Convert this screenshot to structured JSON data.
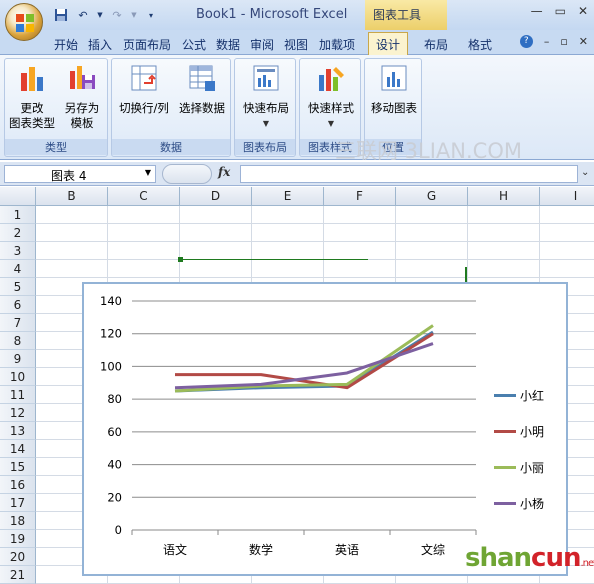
{
  "window": {
    "title": "Book1 - Microsoft Excel",
    "context_tools": "图表工具",
    "controls": [
      "—",
      "▭",
      "✕"
    ]
  },
  "tabs": [
    "开始",
    "插入",
    "页面布局",
    "公式",
    "数据",
    "审阅",
    "视图",
    "加载项",
    "设计",
    "布局",
    "格式"
  ],
  "active_tab": "设计",
  "ribbon": {
    "groups": [
      {
        "label": "类型",
        "buttons": [
          {
            "label": "更改\n图表类型",
            "icon": "change-chart-type-icon"
          },
          {
            "label": "另存为\n模板",
            "icon": "save-template-icon"
          }
        ]
      },
      {
        "label": "数据",
        "buttons": [
          {
            "label": "切换行/列",
            "icon": "switch-row-col-icon"
          },
          {
            "label": "选择数据",
            "icon": "select-data-icon"
          }
        ]
      },
      {
        "label": "图表布局",
        "buttons": [
          {
            "label": "快速布局",
            "icon": "quick-layout-icon"
          }
        ]
      },
      {
        "label": "图表样式",
        "buttons": [
          {
            "label": "快速样式",
            "icon": "quick-style-icon"
          }
        ]
      },
      {
        "label": "位置",
        "buttons": [
          {
            "label": "移动图表",
            "icon": "move-chart-icon"
          }
        ]
      }
    ]
  },
  "formula_bar": {
    "name_box": "图表 4",
    "fx": "fx",
    "value": ""
  },
  "sheet": {
    "columns": [
      "B",
      "C",
      "D",
      "E",
      "F",
      "G",
      "H",
      "I"
    ],
    "rows": [
      "1",
      "2",
      "3",
      "4",
      "5",
      "6",
      "7",
      "8",
      "9",
      "10",
      "11",
      "12",
      "13",
      "14",
      "15",
      "16",
      "17",
      "18",
      "19",
      "20",
      "21"
    ]
  },
  "watermark": "三联网 3LIAN.COM",
  "site_logo": {
    "part1": "shan",
    "part2": "cun",
    "suffix": ".net"
  },
  "chart_data": {
    "type": "line",
    "categories": [
      "语文",
      "数学",
      "英语",
      "文综"
    ],
    "ylim": [
      0,
      140
    ],
    "yticks": [
      0,
      20,
      40,
      60,
      80,
      100,
      120,
      140
    ],
    "grid": true,
    "legend_position": "right",
    "series": [
      {
        "name": "小红",
        "color": "#4a7fae",
        "values": [
          85,
          87,
          88,
          121
        ]
      },
      {
        "name": "小明",
        "color": "#b24a46",
        "values": [
          95,
          95,
          87,
          120
        ]
      },
      {
        "name": "小丽",
        "color": "#9bbb59",
        "values": [
          85,
          88,
          89,
          125
        ]
      },
      {
        "name": "小杨",
        "color": "#7d60a0",
        "values": [
          87,
          89,
          96,
          114
        ]
      }
    ]
  }
}
